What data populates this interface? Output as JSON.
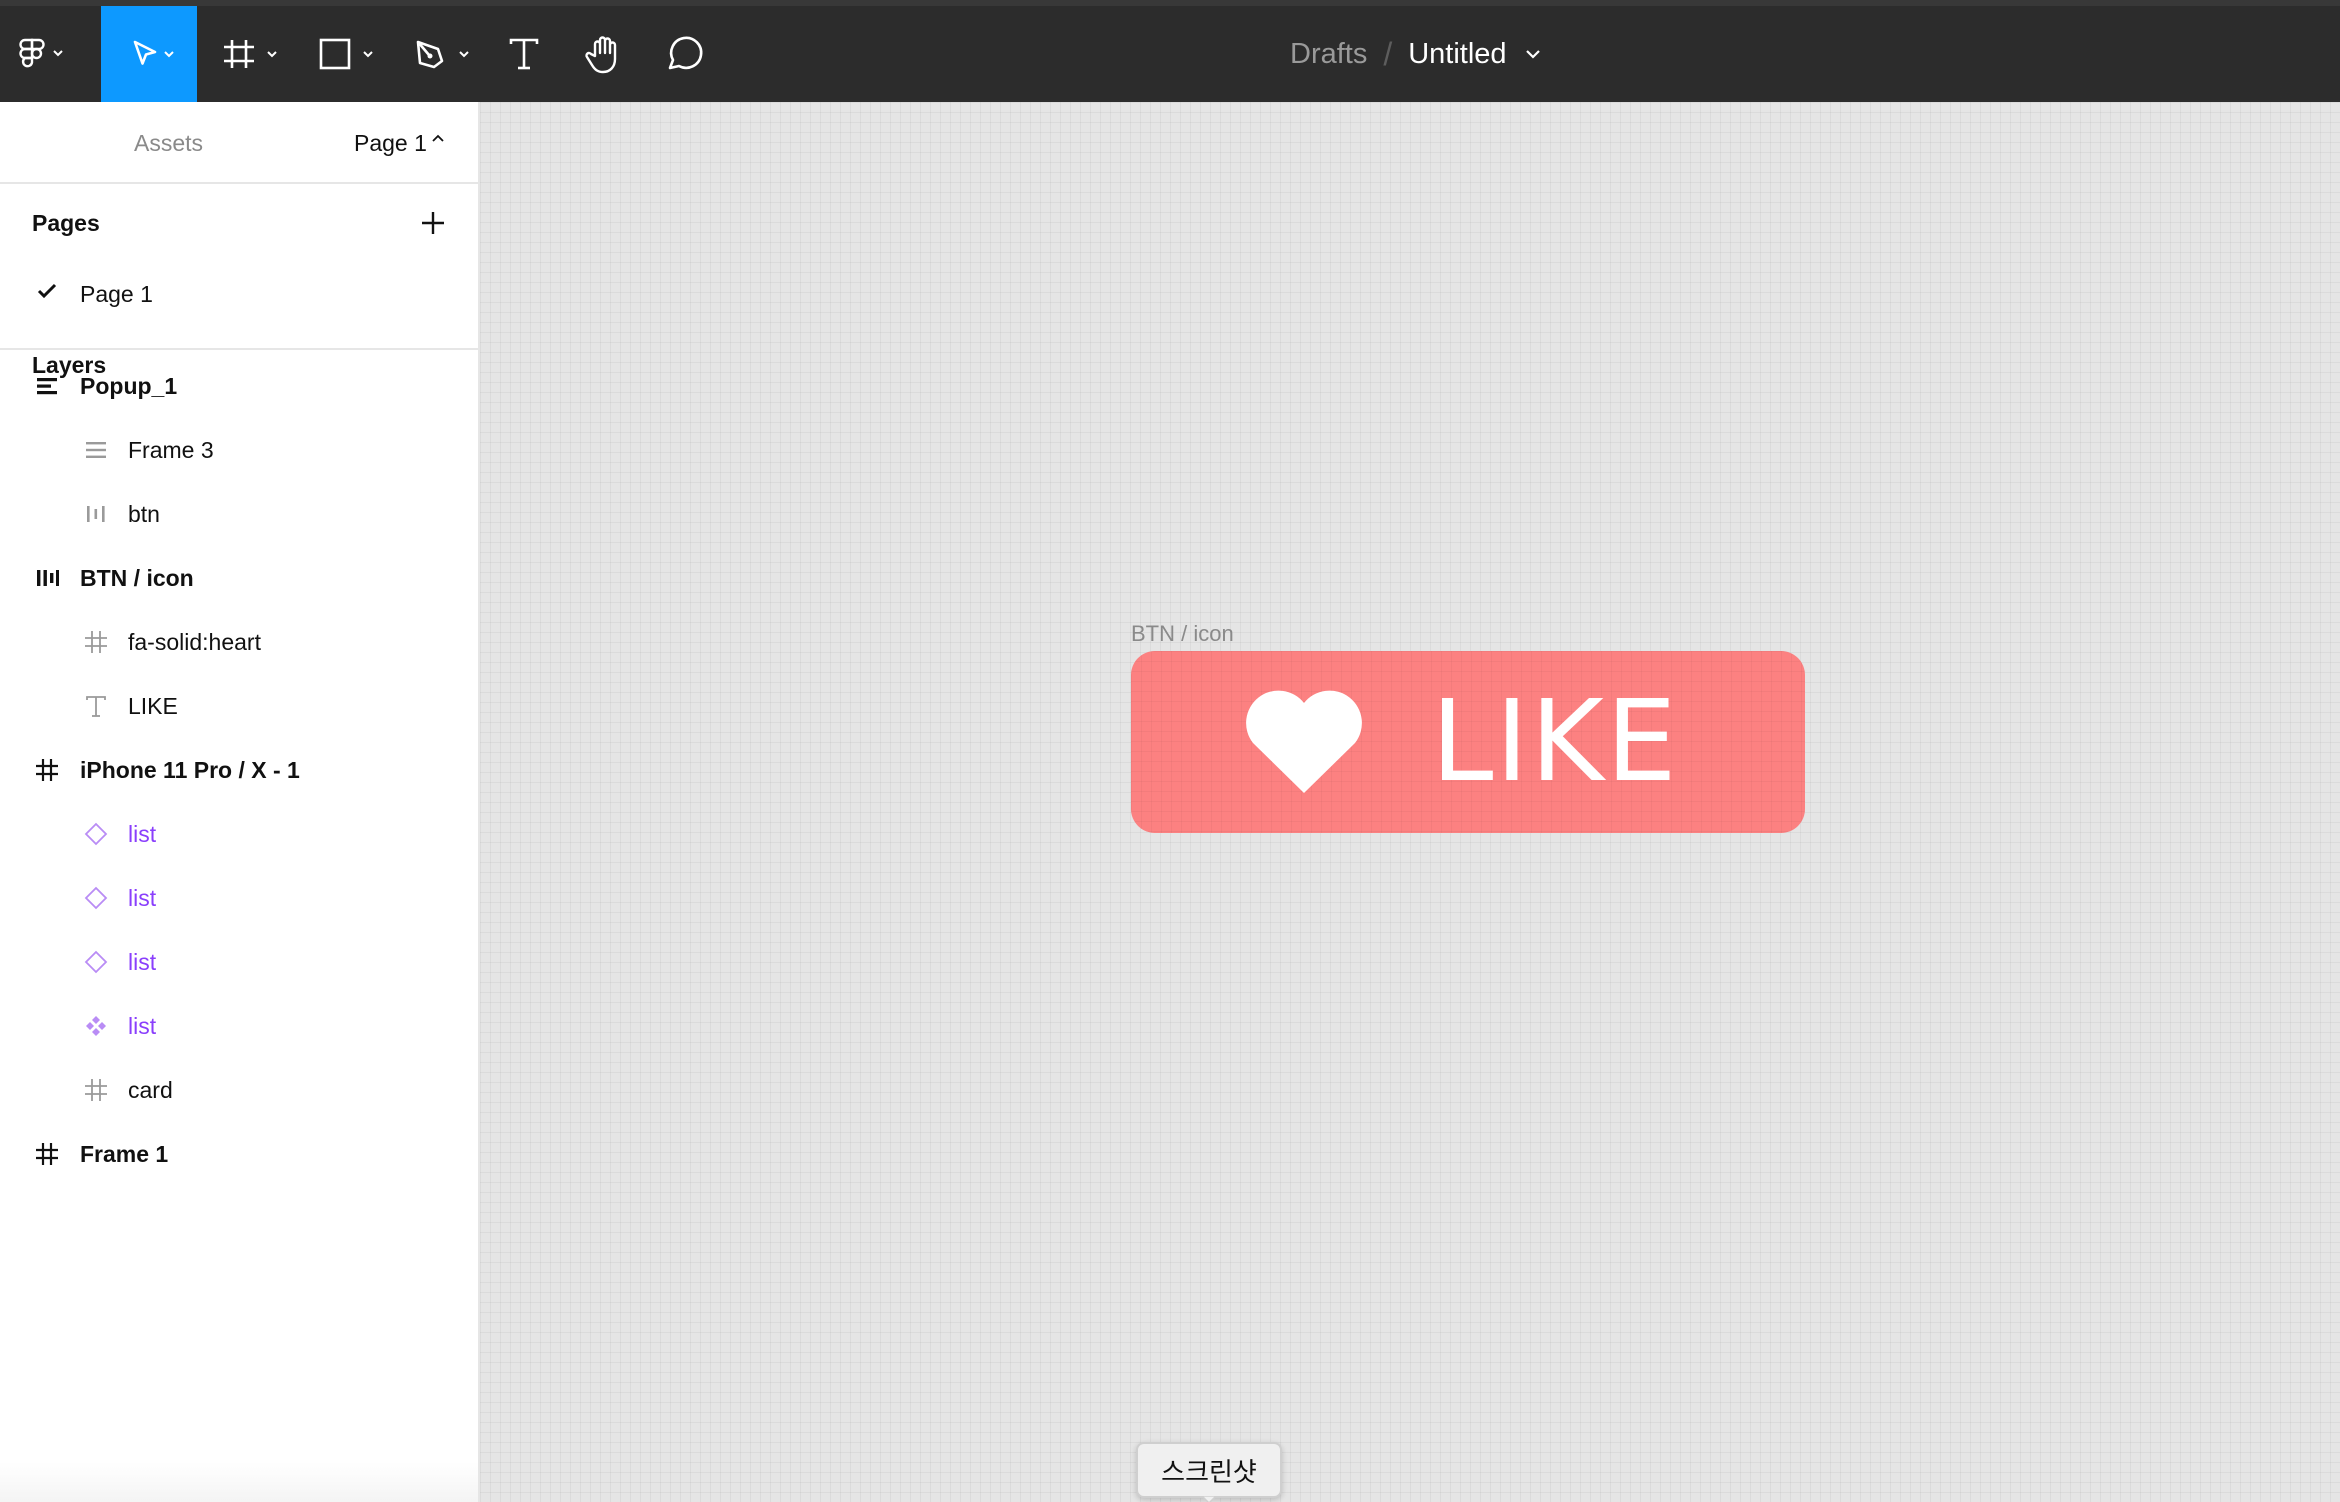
{
  "toolbar": {
    "tools": [
      {
        "name": "main-menu",
        "icon": "figma-logo-icon"
      },
      {
        "name": "move",
        "icon": "cursor-arrow-icon",
        "active": true
      },
      {
        "name": "frame",
        "icon": "frame-hash-icon"
      },
      {
        "name": "shape",
        "icon": "rectangle-icon"
      },
      {
        "name": "pen",
        "icon": "pen-icon"
      },
      {
        "name": "text",
        "icon": "text-t-icon"
      },
      {
        "name": "hand",
        "icon": "hand-icon"
      },
      {
        "name": "comment",
        "icon": "comment-bubble-icon"
      }
    ],
    "breadcrumb": {
      "folder": "Drafts",
      "separator": "/",
      "file": "Untitled"
    },
    "colors": {
      "bar": "#2c2c2c",
      "active_tool": "#0d99ff"
    }
  },
  "left_panel": {
    "tabs": {
      "layers": "Layers",
      "assets": "Assets",
      "page": "Page 1"
    },
    "pages": {
      "heading": "Pages",
      "items": [
        {
          "label": "Page 1",
          "selected": true
        }
      ]
    },
    "layers": [
      {
        "label": "Popup_1",
        "icon": "vertical-autolayout-icon",
        "level": 0
      },
      {
        "label": "Frame 3",
        "icon": "vertical-autolayout-icon",
        "level": 1
      },
      {
        "label": "btn",
        "icon": "horizontal-autolayout-icon",
        "level": 1
      },
      {
        "label": "BTN / icon",
        "icon": "horizontal-autolayout-icon",
        "level": 0
      },
      {
        "label": "fa-solid:heart",
        "icon": "frame-hash-icon",
        "level": 1
      },
      {
        "label": "LIKE",
        "icon": "text-t-icon",
        "level": 1
      },
      {
        "label": "iPhone 11 Pro / X - 1",
        "icon": "frame-hash-icon",
        "level": 0
      },
      {
        "label": "list",
        "icon": "component-instance-icon",
        "level": 1
      },
      {
        "label": "list",
        "icon": "component-instance-icon",
        "level": 1
      },
      {
        "label": "list",
        "icon": "component-instance-icon",
        "level": 1
      },
      {
        "label": "list",
        "icon": "main-component-icon",
        "level": 1
      },
      {
        "label": "card",
        "icon": "frame-hash-icon",
        "level": 1
      },
      {
        "label": "Frame 1",
        "icon": "frame-hash-icon",
        "level": 0
      }
    ],
    "component_color": "#8a3ffc"
  },
  "canvas": {
    "frame_label": "BTN / icon",
    "button": {
      "text": "LIKE",
      "icon": "heart-icon",
      "color": "#fc8181"
    },
    "tooltip": "스크린샷"
  }
}
